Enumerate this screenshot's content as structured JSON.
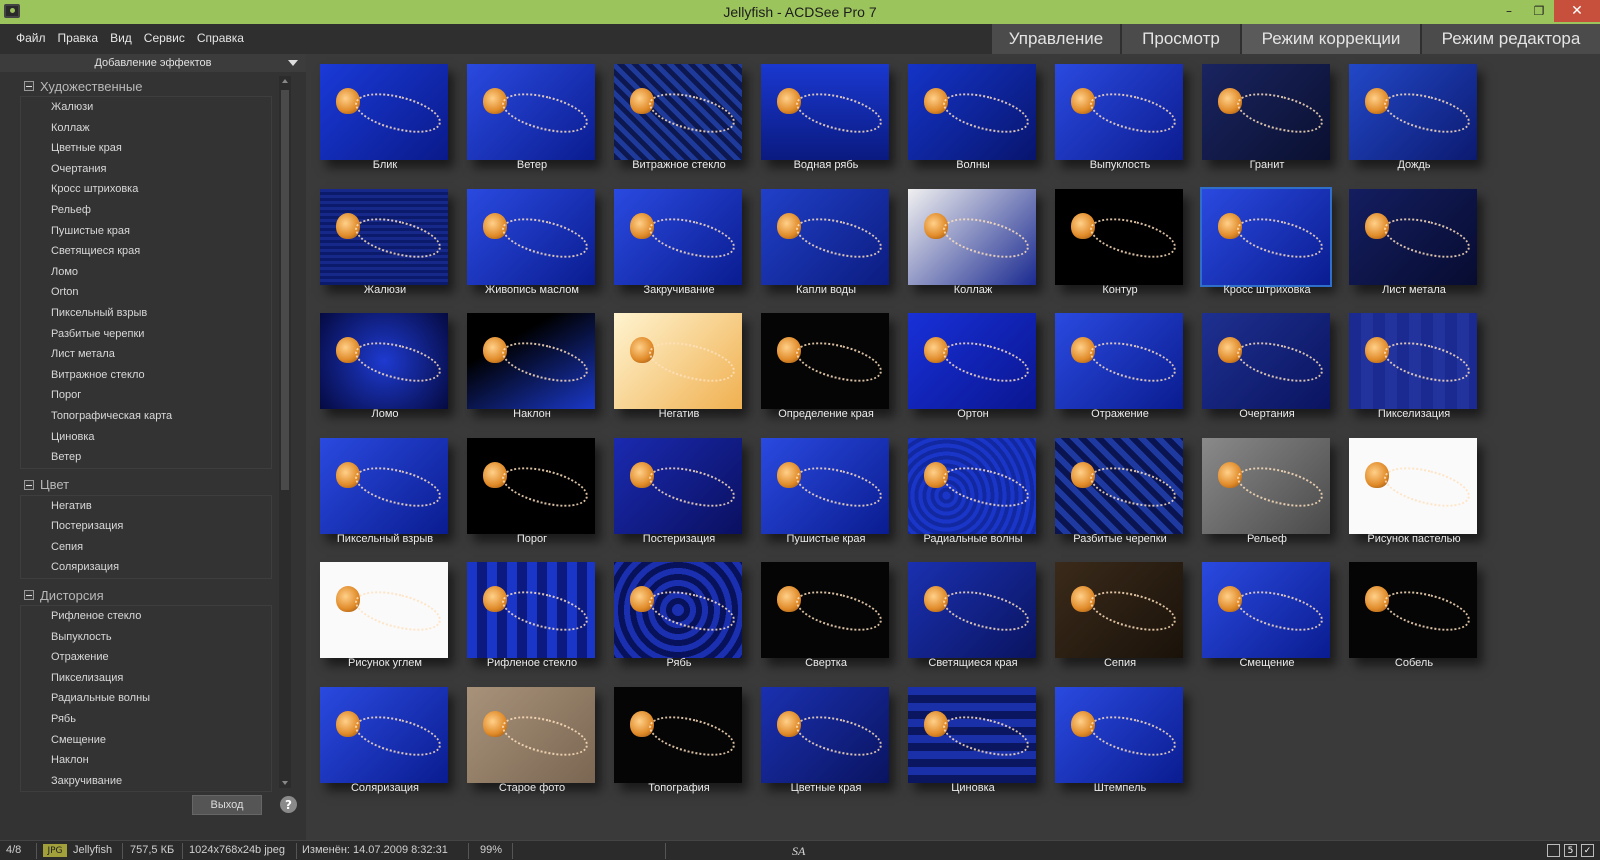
{
  "window": {
    "title": "Jellyfish - ACDSee Pro 7",
    "minimize": "–",
    "maximize": "❐",
    "close": "✕"
  },
  "menu": [
    "Файл",
    "Правка",
    "Вид",
    "Сервис",
    "Справка"
  ],
  "modes": [
    "Управление",
    "Просмотр",
    "Режим коррекции",
    "Режим редактора"
  ],
  "panel": {
    "header": "Добавление эффектов",
    "groups": [
      {
        "name": "Художественные",
        "items": [
          "Жалюзи",
          "Коллаж",
          "Цветные края",
          "Очертания",
          "Кросс штриховка",
          "Рельеф",
          "Пушистые края",
          "Светящиеся края",
          "Ломо",
          "Orton",
          "Пиксельный взрыв",
          "Разбитые черепки",
          "Лист метала",
          "Витражное стекло",
          "Порог",
          "Топографическая карта",
          "Циновка",
          "Ветер"
        ]
      },
      {
        "name": "Цвет",
        "items": [
          "Негатив",
          "Постеризация",
          "Сепия",
          "Соляризация"
        ]
      },
      {
        "name": "Дисторсия",
        "items": [
          "Рифленое стекло",
          "Выпуклость",
          "Отражение",
          "Пикселизация",
          "Радиальные волны",
          "Рябь",
          "Смещение",
          "Наклон",
          "Закручивание"
        ]
      }
    ],
    "exit_label": "Выход",
    "help_label": "?"
  },
  "thumbnails": [
    {
      "label": "Блик",
      "bg": "linear-gradient(135deg,#1a3ad8,#0a1a8a)"
    },
    {
      "label": "Ветер",
      "bg": "linear-gradient(135deg,#2a4ae0,#0a1c90)"
    },
    {
      "label": "Витражное стекло",
      "bg": "repeating-linear-gradient(45deg,#0d1850 0 5px,#1e3a9a 5px 10px)"
    },
    {
      "label": "Водная рябь",
      "bg": "linear-gradient(180deg,#1a38d0,#0a1a80)"
    },
    {
      "label": "Волны",
      "bg": "linear-gradient(135deg,#1434c8,#08156e)"
    },
    {
      "label": "Выпуклость",
      "bg": "linear-gradient(135deg,#2a4ae0,#0c1c90)"
    },
    {
      "label": "Гранит",
      "bg": "linear-gradient(135deg,#1a2460,#0a1030)"
    },
    {
      "label": "Дождь",
      "bg": "linear-gradient(135deg,#2248c8,#0c1a70)"
    },
    {
      "label": "Жалюзи",
      "bg": "repeating-linear-gradient(0deg,#0b1a6a 0 3px,#16288a 3px 6px)"
    },
    {
      "label": "Живопись маслом",
      "bg": "linear-gradient(135deg,#2a4ae0,#0a1c90)"
    },
    {
      "label": "Закручивание",
      "bg": "linear-gradient(135deg,#2a4ae0,#0a1c90)"
    },
    {
      "label": "Капли воды",
      "bg": "linear-gradient(135deg,#2040c8,#0c1c80)"
    },
    {
      "label": "Коллаж",
      "bg": "linear-gradient(135deg,#f0f0f0,#1a2a90)"
    },
    {
      "label": "Контур",
      "bg": "#000000"
    },
    {
      "label": "Кросс штриховка",
      "bg": "linear-gradient(135deg,#2a4ae0,#0a1c90)"
    },
    {
      "label": "Лист метала",
      "bg": "linear-gradient(135deg,#141e60,#070c30)"
    },
    {
      "label": "Ломо",
      "bg": "radial-gradient(circle,#1e3ad0,#050a40)"
    },
    {
      "label": "Наклон",
      "bg": "linear-gradient(150deg,#000000 30%,#1a38c8)"
    },
    {
      "label": "Негатив",
      "bg": "linear-gradient(135deg,#fff4d0,#f0b050)"
    },
    {
      "label": "Определение края",
      "bg": "#050505"
    },
    {
      "label": "Ортон",
      "bg": "linear-gradient(135deg,#1830d8,#0a1690)"
    },
    {
      "label": "Отражение",
      "bg": "linear-gradient(135deg,#2a4ae0,#0a1c90)"
    },
    {
      "label": "Очертания",
      "bg": "linear-gradient(135deg,#1e3090,#0a1460)"
    },
    {
      "label": "Пикселизация",
      "bg": "repeating-linear-gradient(90deg,#1a2a90 0 12px,#22339e 12px 24px)"
    },
    {
      "label": "Пиксельный взрыв",
      "bg": "linear-gradient(135deg,#2a4ae0,#0a1c90)"
    },
    {
      "label": "Порог",
      "bg": "#000000"
    },
    {
      "label": "Постеризация",
      "bg": "linear-gradient(135deg,#1a2ab0,#0a1060)"
    },
    {
      "label": "Пушистые края",
      "bg": "linear-gradient(135deg,#2a4ae0,#0a1c90)"
    },
    {
      "label": "Радиальные волны",
      "bg": "repeating-radial-gradient(circle at 30% 60%,#1a36c8 0 4px,#1228a0 4px 8px)"
    },
    {
      "label": "Разбитые черепки",
      "bg": "repeating-linear-gradient(45deg,#0a1450 0 6px,#1e3aa0 6px 12px)"
    },
    {
      "label": "Рельеф",
      "bg": "linear-gradient(135deg,#8a8a8a,#4a4a4a)"
    },
    {
      "label": "Рисунок пастелью",
      "bg": "#fafafa"
    },
    {
      "label": "Рисунок углем",
      "bg": "#fafafa"
    },
    {
      "label": "Рифленое стекло",
      "bg": "repeating-linear-gradient(90deg,#1a36c8 0 10px,#0c1a80 10px 20px)"
    },
    {
      "label": "Рябь",
      "bg": "repeating-radial-gradient(circle,#1a30b0 0 6px,#08125a 6px 12px)"
    },
    {
      "label": "Свертка",
      "bg": "#050505"
    },
    {
      "label": "Светящиеся края",
      "bg": "linear-gradient(135deg,#1a30b0,#0a1460)"
    },
    {
      "label": "Сепия",
      "bg": "linear-gradient(135deg,#3a2a1a,#1a120a)"
    },
    {
      "label": "Смещение",
      "bg": "linear-gradient(135deg,#2a4ae0,#0a1c90)"
    },
    {
      "label": "Собель",
      "bg": "#050505"
    },
    {
      "label": "Соляризация",
      "bg": "linear-gradient(135deg,#2a4ae0,#0a1c90)"
    },
    {
      "label": "Старое фото",
      "bg": "linear-gradient(135deg,#a8927a,#7a6652)"
    },
    {
      "label": "Топография",
      "bg": "#050505"
    },
    {
      "label": "Цветные края",
      "bg": "linear-gradient(135deg,#1a30b0,#0a1460)"
    },
    {
      "label": "Циновка",
      "bg": "repeating-linear-gradient(0deg,#0a1660 0 8px,#1a30a8 8px 16px)"
    },
    {
      "label": "Штемпель",
      "bg": "linear-gradient(135deg,#2a4ae0,#0a1c90)"
    }
  ],
  "status": {
    "position": "4/8",
    "format": "JPG",
    "filename": "Jellyfish",
    "size": "757,5 КБ",
    "dimensions": "1024x768x24b jpeg",
    "modified": "Изменён: 14.07.2009 8:32:31",
    "zoom": "99%",
    "sa": "SA",
    "icon_number": "5",
    "icon_check": "✓"
  }
}
